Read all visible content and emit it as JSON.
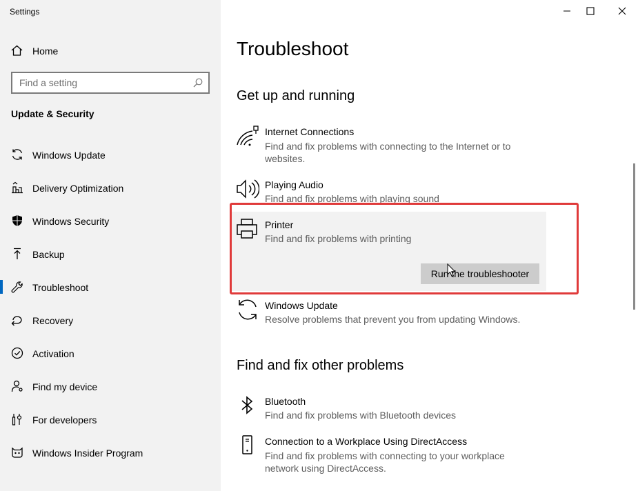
{
  "app": {
    "title": "Settings"
  },
  "sidebar": {
    "home_label": "Home",
    "search_placeholder": "Find a setting",
    "section_title": "Update & Security",
    "items": [
      {
        "label": "Windows Update",
        "icon": "sync-icon"
      },
      {
        "label": "Delivery Optimization",
        "icon": "delivery-optimization-icon"
      },
      {
        "label": "Windows Security",
        "icon": "shield-icon"
      },
      {
        "label": "Backup",
        "icon": "backup-arrow-icon"
      },
      {
        "label": "Troubleshoot",
        "icon": "wrench-icon",
        "active": true
      },
      {
        "label": "Recovery",
        "icon": "recovery-icon"
      },
      {
        "label": "Activation",
        "icon": "check-circle-icon"
      },
      {
        "label": "Find my device",
        "icon": "person-pin-icon"
      },
      {
        "label": "For developers",
        "icon": "developer-tools-icon"
      },
      {
        "label": "Windows Insider Program",
        "icon": "insider-cat-icon"
      }
    ]
  },
  "main": {
    "title": "Troubleshoot",
    "group1_title": "Get up and running",
    "group2_title": "Find and fix other problems",
    "items": [
      {
        "name": "Internet Connections",
        "desc": "Find and fix problems with connecting to the Internet or to websites."
      },
      {
        "name": "Playing Audio",
        "desc": "Find and fix problems with playing sound"
      },
      {
        "name": "Printer",
        "desc": "Find and fix problems with printing",
        "button": "Run the troubleshooter"
      },
      {
        "name": "Windows Update",
        "desc": "Resolve problems that prevent you from updating Windows."
      },
      {
        "name": "Bluetooth",
        "desc": "Find and fix problems with Bluetooth devices"
      },
      {
        "name": "Connection to a Workplace Using DirectAccess",
        "desc": "Find and fix problems with connecting to your workplace network using DirectAccess."
      }
    ]
  },
  "colors": {
    "accent": "#0067c0",
    "highlight": "#e03a3a",
    "sidebar_bg": "#f2f2f2"
  }
}
